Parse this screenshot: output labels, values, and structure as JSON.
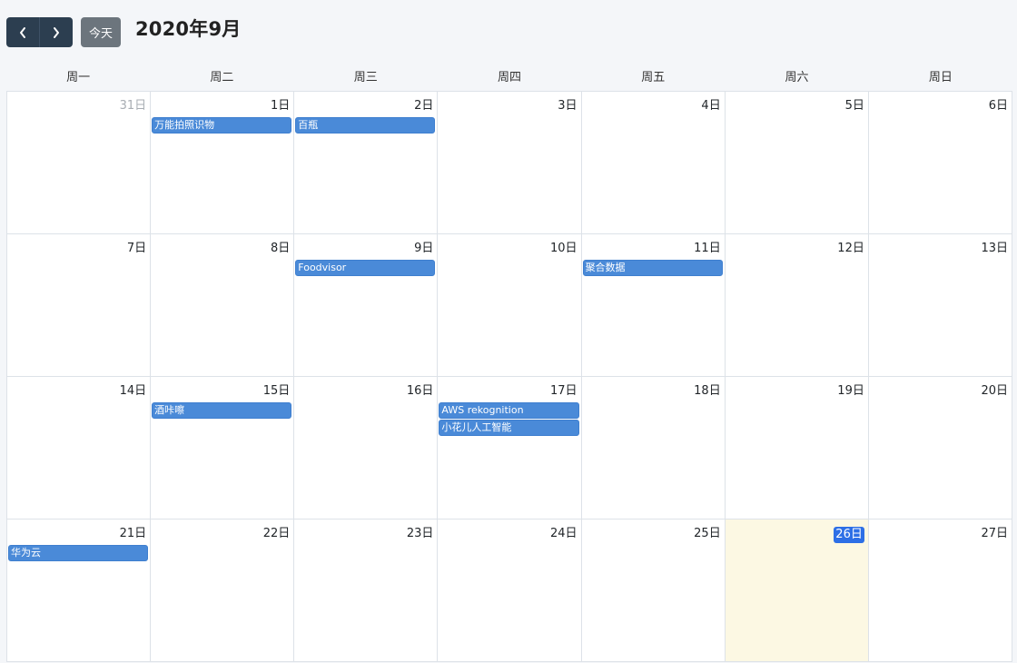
{
  "toolbar": {
    "prev_icon": "chevron-left-icon",
    "next_icon": "chevron-right-icon",
    "today_label": "今天",
    "title": "2020年9月"
  },
  "weekdays": [
    "周一",
    "周二",
    "周三",
    "周四",
    "周五",
    "周六",
    "周日"
  ],
  "weeks": [
    {
      "days": [
        {
          "label": "31日",
          "events": []
        },
        {
          "label": "1日",
          "events": [
            "万能拍照识物"
          ]
        },
        {
          "label": "2日",
          "events": [
            "百瓶"
          ]
        },
        {
          "label": "3日",
          "events": []
        },
        {
          "label": "4日",
          "events": []
        },
        {
          "label": "5日",
          "events": []
        },
        {
          "label": "6日",
          "events": []
        }
      ]
    },
    {
      "days": [
        {
          "label": "7日",
          "events": []
        },
        {
          "label": "8日",
          "events": []
        },
        {
          "label": "9日",
          "events": [
            "Foodvisor"
          ]
        },
        {
          "label": "10日",
          "events": []
        },
        {
          "label": "11日",
          "events": [
            "聚合数据"
          ]
        },
        {
          "label": "12日",
          "events": []
        },
        {
          "label": "13日",
          "events": []
        }
      ]
    },
    {
      "days": [
        {
          "label": "14日",
          "events": []
        },
        {
          "label": "15日",
          "events": [
            "酒咔嚓"
          ]
        },
        {
          "label": "16日",
          "events": []
        },
        {
          "label": "17日",
          "events": [
            "AWS rekognition",
            "小花儿人工智能"
          ]
        },
        {
          "label": "18日",
          "events": []
        },
        {
          "label": "19日",
          "events": []
        },
        {
          "label": "20日",
          "events": []
        }
      ]
    },
    {
      "days": [
        {
          "label": "21日",
          "events": [
            "华为云"
          ]
        },
        {
          "label": "22日",
          "events": []
        },
        {
          "label": "23日",
          "events": []
        },
        {
          "label": "24日",
          "events": []
        },
        {
          "label": "25日",
          "events": []
        },
        {
          "label": "26日",
          "events": []
        },
        {
          "label": "27日",
          "events": []
        }
      ]
    }
  ],
  "colors": {
    "nav_bg": "#2c3e50",
    "today_btn_bg": "#6c757d",
    "event_bg": "#4a8ad8",
    "today_cell_bg": "#fcf8e3",
    "today_badge_bg": "#2d6fe6",
    "other_month_text": "#a8adb3"
  }
}
